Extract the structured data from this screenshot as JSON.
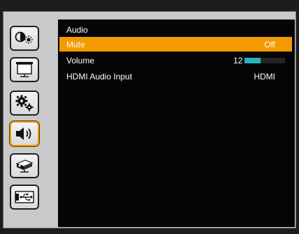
{
  "menu": {
    "title": "Audio",
    "items": [
      {
        "label": "Mute",
        "value": "Off",
        "selected": true
      },
      {
        "label": "Volume",
        "value": "12",
        "level": 0.4,
        "selected": false
      },
      {
        "label": "HDMI Audio Input",
        "value": "HDMI",
        "selected": false
      }
    ]
  },
  "sidebar": {
    "items": [
      {
        "icon": "brightness-contrast-icon",
        "active": false
      },
      {
        "icon": "screen-icon",
        "active": false
      },
      {
        "icon": "gears-icon",
        "active": false
      },
      {
        "icon": "speaker-icon",
        "active": true
      },
      {
        "icon": "projector-icon",
        "active": false
      },
      {
        "icon": "usb-icon",
        "active": false
      }
    ]
  },
  "colors": {
    "accent": "#f29a00",
    "volume_bar": "#2ab0c6",
    "panel_bg": "#050505",
    "frame_bg": "#c9c9c9"
  }
}
